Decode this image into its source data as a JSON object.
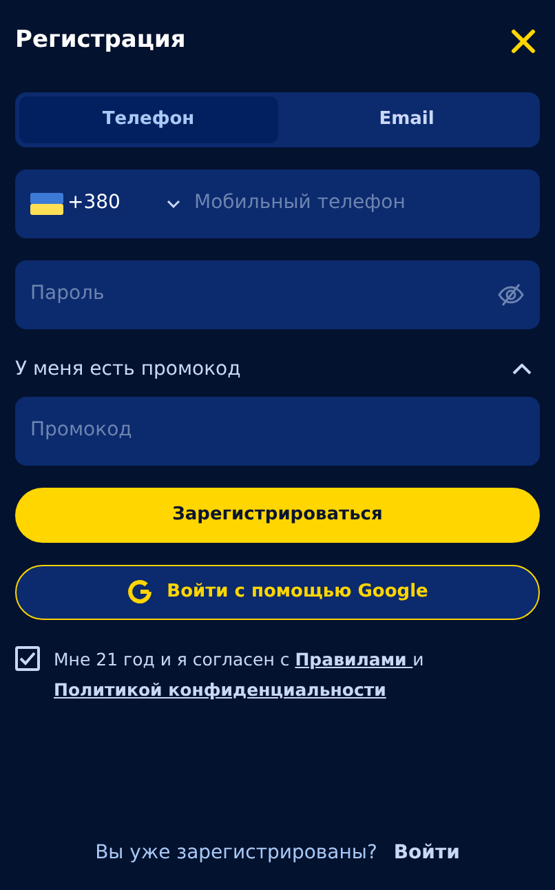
{
  "header": {
    "title": "Регистрация"
  },
  "tabs": [
    {
      "label": "Телефон",
      "selected": true
    },
    {
      "label": "Email",
      "selected": false
    }
  ],
  "phone": {
    "country_code": "+380",
    "placeholder": "Мобильный телефон"
  },
  "password": {
    "placeholder": "Пароль"
  },
  "promo": {
    "label": "У меня есть промокод",
    "expanded": true,
    "placeholder": "Промокод"
  },
  "register_button": "Зарегистрироваться",
  "google_button": "Войти с помощью Google",
  "agreement": {
    "checked": true,
    "text": "Мне 21 год и я согласен с ",
    "link_1": "Правилами ",
    "middle": "и ",
    "link_2": "Политикой конфиденциальности"
  },
  "footer": {
    "question": "Вы уже зарегистрированы?",
    "link": "Войти"
  }
}
